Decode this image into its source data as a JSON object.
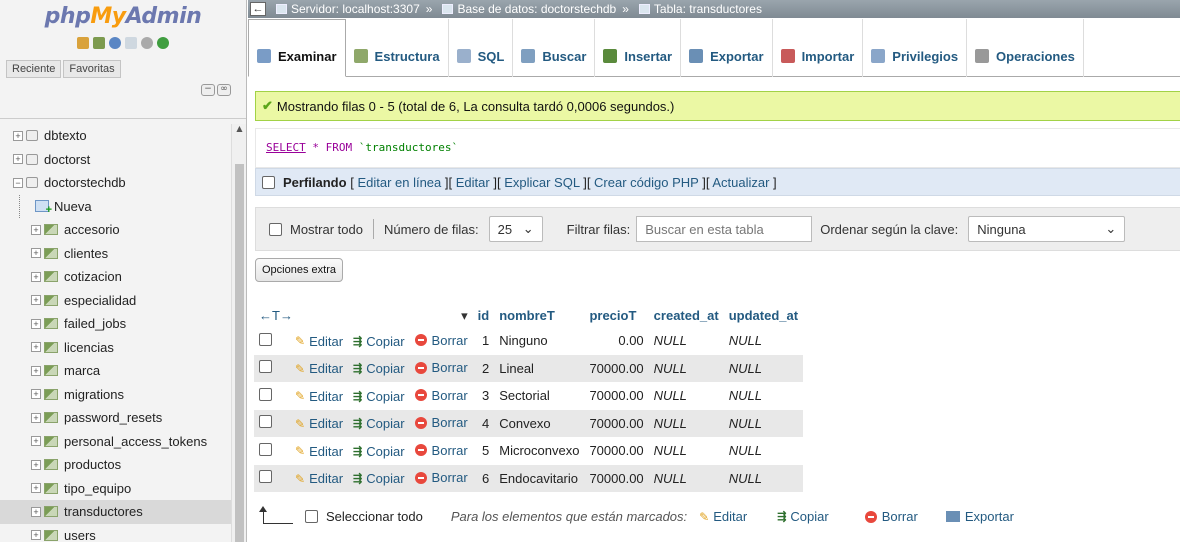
{
  "app": {
    "logo_php": "php",
    "logo_my": "My",
    "logo_admin": "Admin"
  },
  "nav_tabs": [
    "Reciente",
    "Favoritas"
  ],
  "tree": [
    {
      "label": "dbtexto",
      "type": "db"
    },
    {
      "label": "doctorst",
      "type": "db"
    },
    {
      "label": "doctorstechdb",
      "type": "db-open"
    },
    {
      "label": "Nueva",
      "type": "new"
    },
    {
      "label": "accesorio",
      "type": "table"
    },
    {
      "label": "clientes",
      "type": "table"
    },
    {
      "label": "cotizacion",
      "type": "table"
    },
    {
      "label": "especialidad",
      "type": "table"
    },
    {
      "label": "failed_jobs",
      "type": "table"
    },
    {
      "label": "licencias",
      "type": "table"
    },
    {
      "label": "marca",
      "type": "table"
    },
    {
      "label": "migrations",
      "type": "table"
    },
    {
      "label": "password_resets",
      "type": "table"
    },
    {
      "label": "personal_access_tokens",
      "type": "table"
    },
    {
      "label": "productos",
      "type": "table"
    },
    {
      "label": "tipo_equipo",
      "type": "table"
    },
    {
      "label": "transductores",
      "type": "table",
      "selected": true
    },
    {
      "label": "users",
      "type": "table"
    }
  ],
  "breadcrumb": {
    "server": "Servidor: localhost:3307",
    "database": "Base de datos: doctorstechdb",
    "table": "Tabla: transductores"
  },
  "tabs": [
    {
      "label": "Examinar",
      "icon": "browse-icon",
      "color": "#7a9cc6",
      "active": true
    },
    {
      "label": "Estructura",
      "icon": "structure-icon",
      "color": "#8fa86a"
    },
    {
      "label": "SQL",
      "icon": "sql-icon",
      "color": "#9ab0cc"
    },
    {
      "label": "Buscar",
      "icon": "search-icon",
      "color": "#7f9fc0"
    },
    {
      "label": "Insertar",
      "icon": "insert-icon",
      "color": "#5a8a3c"
    },
    {
      "label": "Exportar",
      "icon": "export-icon",
      "color": "#6a8fb5"
    },
    {
      "label": "Importar",
      "icon": "import-icon",
      "color": "#c85a5a"
    },
    {
      "label": "Privilegios",
      "icon": "privileges-icon",
      "color": "#8aa6c9"
    },
    {
      "label": "Operaciones",
      "icon": "operations-icon",
      "color": "#999999"
    }
  ],
  "success_message": "Mostrando filas 0 - 5 (total de 6, La consulta tardó 0,0006 segundos.)",
  "sql": {
    "select": "SELECT",
    "star": " * ",
    "from": "FROM",
    "table": " `transductores`"
  },
  "profiling": {
    "label": "Perfilando",
    "links": [
      "Editar en línea",
      "Editar",
      "Explicar SQL",
      "Crear código PHP",
      "Actualizar"
    ]
  },
  "filter": {
    "show_all": "Mostrar todo",
    "rows_label": "Número de filas:",
    "rows_value": "25",
    "filter_label": "Filtrar filas:",
    "filter_placeholder": "Buscar en esta tabla",
    "sort_label": "Ordenar según la clave:",
    "sort_value": "Ninguna"
  },
  "extra_options": "Opciones extra",
  "table": {
    "nav_arrows": "←T→",
    "columns": [
      "id",
      "nombreT",
      "precioT",
      "created_at",
      "updated_at"
    ],
    "action_labels": {
      "edit": "Editar",
      "copy": "Copiar",
      "delete": "Borrar"
    },
    "rows": [
      {
        "id": "1",
        "nombreT": "Ninguno",
        "precioT": "0.00",
        "created_at": "NULL",
        "updated_at": "NULL"
      },
      {
        "id": "2",
        "nombreT": "Lineal",
        "precioT": "70000.00",
        "created_at": "NULL",
        "updated_at": "NULL"
      },
      {
        "id": "3",
        "nombreT": "Sectorial",
        "precioT": "70000.00",
        "created_at": "NULL",
        "updated_at": "NULL"
      },
      {
        "id": "4",
        "nombreT": "Convexo",
        "precioT": "70000.00",
        "created_at": "NULL",
        "updated_at": "NULL"
      },
      {
        "id": "5",
        "nombreT": "Microconvexo",
        "precioT": "70000.00",
        "created_at": "NULL",
        "updated_at": "NULL"
      },
      {
        "id": "6",
        "nombreT": "Endocavitario",
        "precioT": "70000.00",
        "created_at": "NULL",
        "updated_at": "NULL"
      }
    ]
  },
  "bottom": {
    "select_all": "Seleccionar todo",
    "marked_label": "Para los elementos que están marcados:",
    "edit": "Editar",
    "copy": "Copiar",
    "delete": "Borrar",
    "export": "Exportar"
  }
}
